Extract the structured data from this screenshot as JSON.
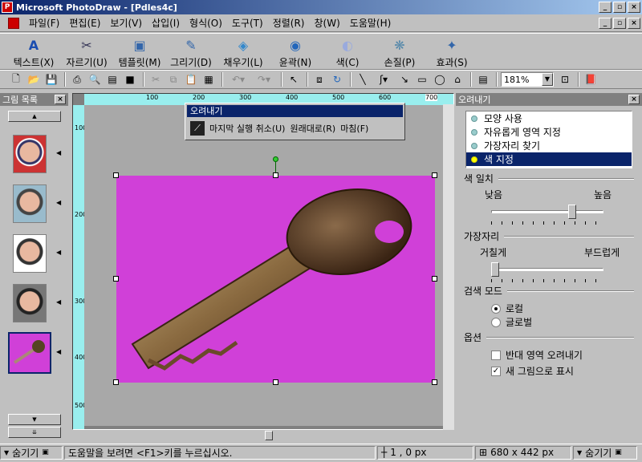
{
  "window": {
    "title": "Microsoft PhotoDraw - [Pdles4c]",
    "min": "_",
    "max": "▫",
    "close": "×"
  },
  "menu": [
    "파일(F)",
    "편집(E)",
    "보기(V)",
    "삽입(I)",
    "형식(O)",
    "도구(T)",
    "정렬(R)",
    "창(W)",
    "도움말(H)"
  ],
  "bigtools": [
    {
      "label": "텍스트(X)",
      "icon": "A"
    },
    {
      "label": "자르기(U)",
      "icon": "✂"
    },
    {
      "label": "템플릿(M)",
      "icon": "▣"
    },
    {
      "label": "그리기(D)",
      "icon": "✎"
    },
    {
      "label": "채우기(L)",
      "icon": "◈"
    },
    {
      "label": "윤곽(N)",
      "icon": "◉"
    },
    {
      "label": "색(C)",
      "icon": "◐"
    },
    {
      "label": "손질(P)",
      "icon": "❋"
    },
    {
      "label": "효과(S)",
      "icon": "✦"
    }
  ],
  "toolbar": {
    "zoom": "181%"
  },
  "left_panel": {
    "title": "그림 목록"
  },
  "floatbar": {
    "title": "오려내기",
    "items": [
      "마지막 실행 취소(U)",
      "원래대로(R)",
      "마침(F)"
    ]
  },
  "ruler": {
    "h": [
      "100",
      "200",
      "300",
      "400",
      "500",
      "600",
      "700"
    ],
    "v": [
      "100",
      "200",
      "300",
      "400",
      "500"
    ]
  },
  "right_panel": {
    "title": "오려내기",
    "options": [
      "모양 사용",
      "자유롭게 영역 지정",
      "가장자리 찾기",
      "색 지정"
    ],
    "color_match": {
      "label": "색 일치",
      "low": "낮음",
      "high": "높음",
      "value": 0.72
    },
    "edge": {
      "label": "가장자리",
      "low": "거칠게",
      "high": "부드럽게",
      "value": 0.0
    },
    "search_mode": {
      "label": "검색 모드",
      "local": "로컬",
      "global": "글로벌",
      "selected": "로컬"
    },
    "options_section": {
      "label": "옵션",
      "invert": "반대 영역 오려내기",
      "new_picture": "새 그림으로 표시",
      "invert_checked": false,
      "new_checked": true
    }
  },
  "status": {
    "hide_left": "숨기기",
    "help": "도움말을 보려면 <F1>키를 누르십시오.",
    "coords": "1 , 0 px",
    "size": "680 x 442 px",
    "hide_right": "숨기기"
  },
  "colors": {
    "photo_bg": "#d040d8",
    "title_bar": "#0a246a",
    "ruler": "#99eeee"
  }
}
